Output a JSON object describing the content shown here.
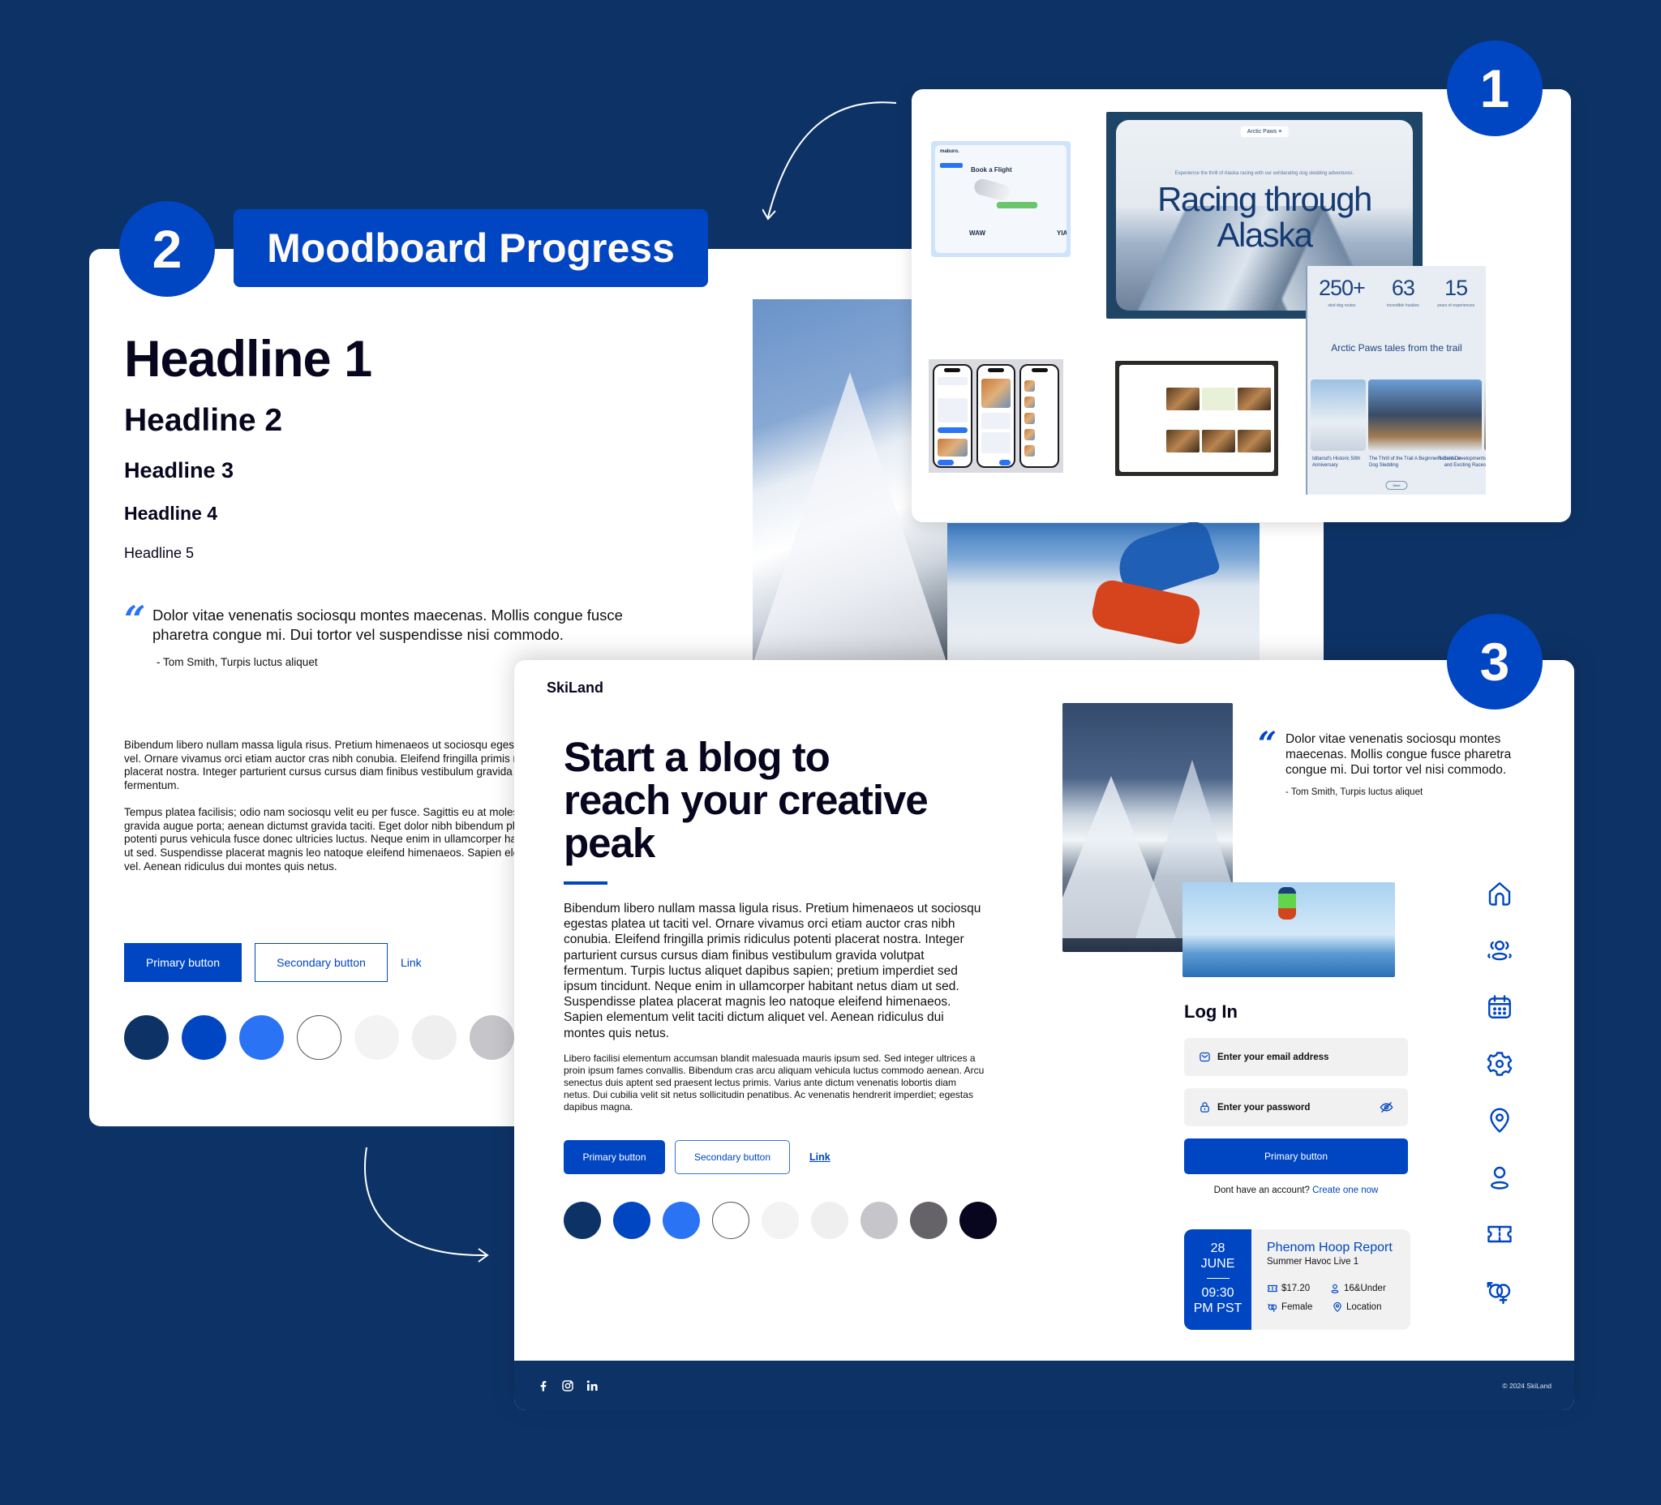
{
  "badges": {
    "one": "1",
    "two": "2",
    "three": "3"
  },
  "moodboard": {
    "title": "Moodboard Progress",
    "headlines": [
      "Headline 1",
      "Headline 2",
      "Headline 3",
      "Headline 4",
      "Headline 5"
    ],
    "quote": {
      "mark": "“",
      "text": "Dolor vitae venenatis sociosqu montes maecenas. Mollis congue fusce pharetra congue mi. Dui tortor vel suspendisse nisi commodo.",
      "author": "- Tom Smith, Turpis luctus aliquet"
    },
    "body": [
      "Bibendum libero nullam massa ligula risus. Pretium himenaeos ut sociosqu egestas platea ut taciti vel. Ornare vivamus orci etiam auctor cras nibh conubia. Eleifend fringilla primis ridiculus potenti placerat nostra. Integer parturient cursus cursus diam finibus vestibulum gravida volutpat fermentum.",
      "Tempus platea facilisis; odio nam sociosqu velit eu per fusce. Sagittis eu at molestie. Pulvinar gravida augue porta; aenean dictumst gravida taciti. Eget dolor nibh bibendum pharetra. Senectus potenti purus vehicula fusce donec ultricies luctus. Neque enim in ullamcorper habitant netus diam ut sed. Suspendisse placerat magnis leo natoque eleifend himenaeos. Sapien elementum velit taciti vel. Aenean ridiculus dui montes quis netus."
    ],
    "buttons": {
      "primary": "Primary button",
      "secondary": "Secondary button",
      "link": "Link"
    },
    "palette": [
      "#0d3366",
      "#0046c3",
      "#2a73f5",
      "#ffffff",
      "#f3f3f3",
      "#efefef",
      "#c5c5ca"
    ]
  },
  "inspiration": {
    "alaska": {
      "nav": "Arctic Paws  ≡",
      "subtitle": "Experience the thrill of Alaska racing with our exhilarating dog sledding adventures.",
      "title": "Racing through Alaska"
    },
    "flight": {
      "logo": "maburo.",
      "heading": "Book a Flight",
      "from": "WAW",
      "to": "YIA"
    },
    "stats": [
      {
        "value": "250+",
        "label": "sled dog routes"
      },
      {
        "value": "63",
        "label": "incredible huskies"
      },
      {
        "value": "15",
        "label": "years of experiences"
      }
    ],
    "tales_title": "Arctic Paws tales from the trail",
    "tales": [
      "Iditarod's Historic 50th Anniversary",
      "The Thrill of the Trail A Beginner's Guide to Dog Sledding",
      "Recent Developments and Exciting Races"
    ],
    "more": "More"
  },
  "skiland": {
    "brand": "SkiLand",
    "hero": "Start a blog to reach your creative peak",
    "body_large": "Bibendum libero nullam massa ligula risus. Pretium himenaeos ut sociosqu egestas platea ut taciti vel. Ornare vivamus orci etiam auctor cras nibh conubia. Eleifend fringilla primis ridiculus potenti placerat nostra. Integer parturient cursus cursus diam finibus vestibulum gravida volutpat fermentum. Turpis luctus aliquet dapibus sapien; pretium imperdiet sed ipsum tincidunt. Neque enim in ullamcorper habitant netus diam ut sed. Suspendisse platea placerat magnis leo natoque eleifend himenaeos. Sapien elementum velit taciti dictum aliquet vel. Aenean ridiculus dui montes quis netus.",
    "body_small": "Libero facilisi elementum accumsan blandit malesuada mauris ipsum sed. Sed integer ultrices a proin ipsum fames convallis. Bibendum cras arcu aliquam vehicula luctus commodo aenean. Arcu senectus duis aptent sed praesent lectus primis. Varius ante dictum venenatis lobortis diam netus. Dui cubilia velit sit netus sollicitudin penatibus. Ac venenatis hendrerit imperdiet; egestas dapibus magna.",
    "buttons": {
      "primary": "Primary button",
      "secondary": "Secondary button",
      "link": "Link"
    },
    "palette": [
      "#0d3366",
      "#0046c3",
      "#2a73f5",
      "#ffffff",
      "#f3f3f3",
      "#efefef",
      "#c5c5ca",
      "#656268",
      "#07061e"
    ],
    "quote": {
      "mark": "“",
      "text": "Dolor vitae venenatis sociosqu montes maecenas. Mollis congue fusce pharetra congue mi. Dui tortor vel  nisi commodo.",
      "author": "- Tom Smith, Turpis luctus aliquet"
    },
    "side_icons": [
      "home-icon",
      "users-group-icon",
      "calendar-icon",
      "gear-icon",
      "location-pin-icon",
      "user-icon",
      "ticket-icon",
      "gender-icon"
    ],
    "login": {
      "title": "Log In",
      "email_placeholder": "Enter your email address",
      "password_placeholder": "Enter your password",
      "submit": "Primary button",
      "signup_prompt": "Dont have an account?",
      "signup_link": "Create one now"
    },
    "event": {
      "day": "28",
      "month": "JUNE",
      "time": "09:30",
      "zone": "PM PST",
      "title": "Phenom Hoop Report",
      "subtitle": "Summer Havoc Live 1",
      "price": "$17.20",
      "age": "16&Under",
      "gender": "Female",
      "location": "Location"
    },
    "footer": {
      "copyright": "© 2024 SkiLand"
    }
  },
  "colors": {
    "background": "#0d3366",
    "accent": "#0046c3",
    "accent_light": "#2a73f5",
    "ink": "#07061e"
  }
}
